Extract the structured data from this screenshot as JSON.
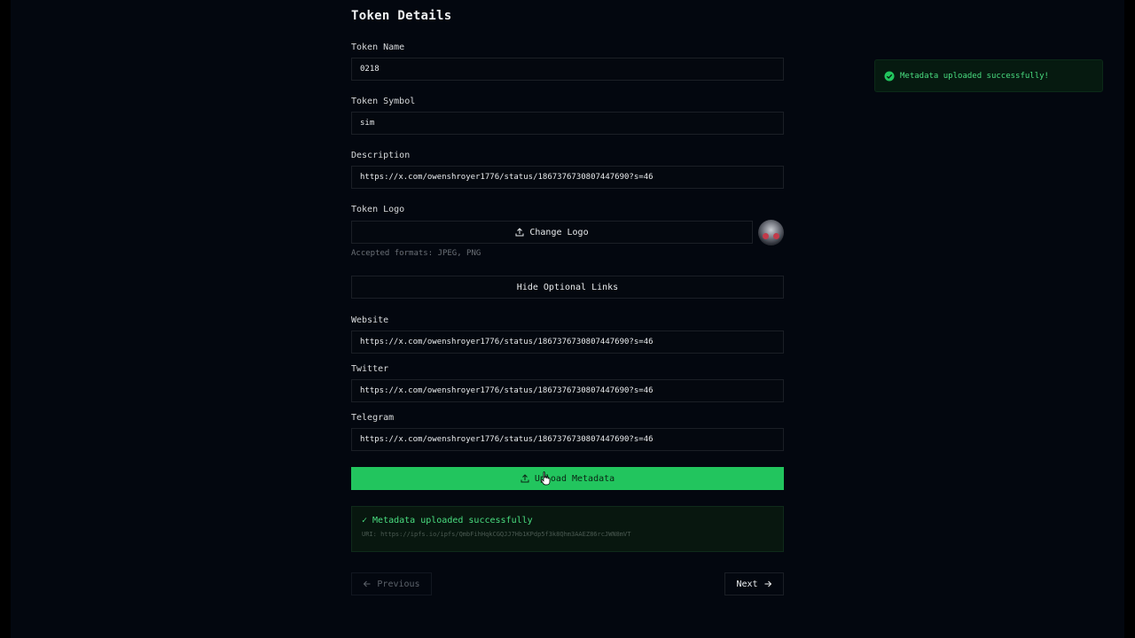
{
  "form": {
    "title": "Token Details",
    "token_name": {
      "label": "Token Name",
      "value": "0218"
    },
    "token_symbol": {
      "label": "Token Symbol",
      "value": "sim"
    },
    "description": {
      "label": "Description",
      "value": "https://x.com/owenshroyer1776/status/1867376730807447690?s=46"
    },
    "token_logo": {
      "label": "Token Logo",
      "button_label": "Change Logo",
      "hint": "Accepted formats: JPEG, PNG"
    },
    "optional_links_toggle": "Hide Optional Links",
    "website": {
      "label": "Website",
      "value": "https://x.com/owenshroyer1776/status/1867376730807447690?s=46"
    },
    "twitter": {
      "label": "Twitter",
      "value": "https://x.com/owenshroyer1776/status/1867376730807447690?s=46"
    },
    "telegram": {
      "label": "Telegram",
      "value": "https://x.com/owenshroyer1776/status/1867376730807447690?s=46"
    },
    "upload_button": "Upload Metadata",
    "success": {
      "title": "✓ Metadata uploaded successfully",
      "uri": "URI: https://ipfs.io/ipfs/QmbFihHqkCGQJJ7Hb1KPdp5f3k8Qhm3AAEZ86rcJWN8mVT"
    },
    "nav": {
      "previous": "Previous",
      "next": "Next"
    }
  },
  "toast": {
    "message": "Metadata uploaded successfully!"
  },
  "colors": {
    "accent": "#22c55e",
    "success_text": "#4ade80",
    "background": "#03070f"
  },
  "icons": [
    "upload-icon",
    "arrow-left-icon",
    "arrow-right-icon",
    "check-circle-icon",
    "pointer-cursor-icon"
  ]
}
